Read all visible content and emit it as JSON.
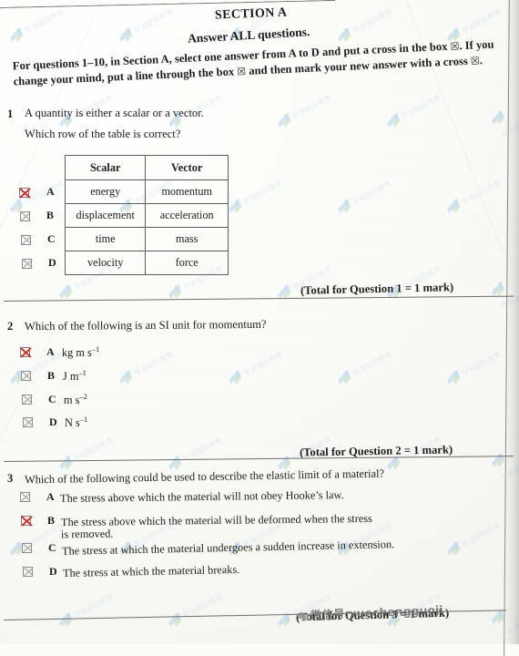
{
  "page": {
    "section_title": "SECTION A",
    "answer_all": "Answer ALL questions.",
    "instruction_line1_a": "For questions 1–10, in Section A, select one answer from A to D and put a cross in the box ",
    "instruction_box_glyph": "☒",
    "instruction_line1_b": ". If you",
    "instruction_line2_a": "change your mind, put a line through the box ",
    "instruction_crossed_box_glyph": "☒",
    "instruction_line2_b": " and then mark your new answer with a cross ",
    "instruction_line2_c": "."
  },
  "questions": [
    {
      "number": "1",
      "stem_line1": "A quantity is either a scalar or a vector.",
      "stem_line2": "Which row of the table is correct?",
      "total": "(Total for Question 1 = 1 mark)",
      "table": {
        "headers": [
          "Scalar",
          "Vector"
        ],
        "rows": [
          {
            "letter": "A",
            "scalar": "energy",
            "vector": "momentum",
            "marked": true
          },
          {
            "letter": "B",
            "scalar": "displacement",
            "vector": "acceleration",
            "marked": false
          },
          {
            "letter": "C",
            "scalar": "time",
            "vector": "mass",
            "marked": false
          },
          {
            "letter": "D",
            "scalar": "velocity",
            "vector": "force",
            "marked": false
          }
        ]
      }
    },
    {
      "number": "2",
      "stem_line1": "Which of the following is an SI unit for momentum?",
      "total": "(Total for Question 2 = 1 mark)",
      "options": [
        {
          "letter": "A",
          "base": "kg m s",
          "sup": "–1",
          "marked": true
        },
        {
          "letter": "B",
          "base": "J m",
          "sup": "–1",
          "marked": false
        },
        {
          "letter": "C",
          "base": "m s",
          "sup": "–2",
          "marked": false
        },
        {
          "letter": "D",
          "base": "N s",
          "sup": "–1",
          "marked": false
        }
      ]
    },
    {
      "number": "3",
      "stem_line1": "Which of the following could be used to describe the elastic limit of a material?",
      "total": "(Total for Question 3 = 1 mark)",
      "options": [
        {
          "letter": "A",
          "text": "The stress above which the material will not obey Hooke’s law.",
          "text2": "",
          "marked": false
        },
        {
          "letter": "B",
          "text": "The stress above which the material will be deformed when the stress",
          "text2": "is removed.",
          "marked": true
        },
        {
          "letter": "C",
          "text": "The stress at which the material undergoes a sudden increase in extension.",
          "text2": "",
          "marked": false
        },
        {
          "letter": "D",
          "text": "The stress at which the material breaks.",
          "text2": "",
          "marked": false
        }
      ]
    }
  ],
  "overlay": {
    "wechat_text": "微信号:xuechengguoji",
    "watermark_text": "学诚国际教育"
  },
  "colors": {
    "paper": "#fbfbf9",
    "ink": "#1d1d1d",
    "rule": "#6e6e6e",
    "cross_red": "#c8342b",
    "checkbox_gray": "#8d8d8d",
    "watermark_blue": "#a9cfe8"
  }
}
